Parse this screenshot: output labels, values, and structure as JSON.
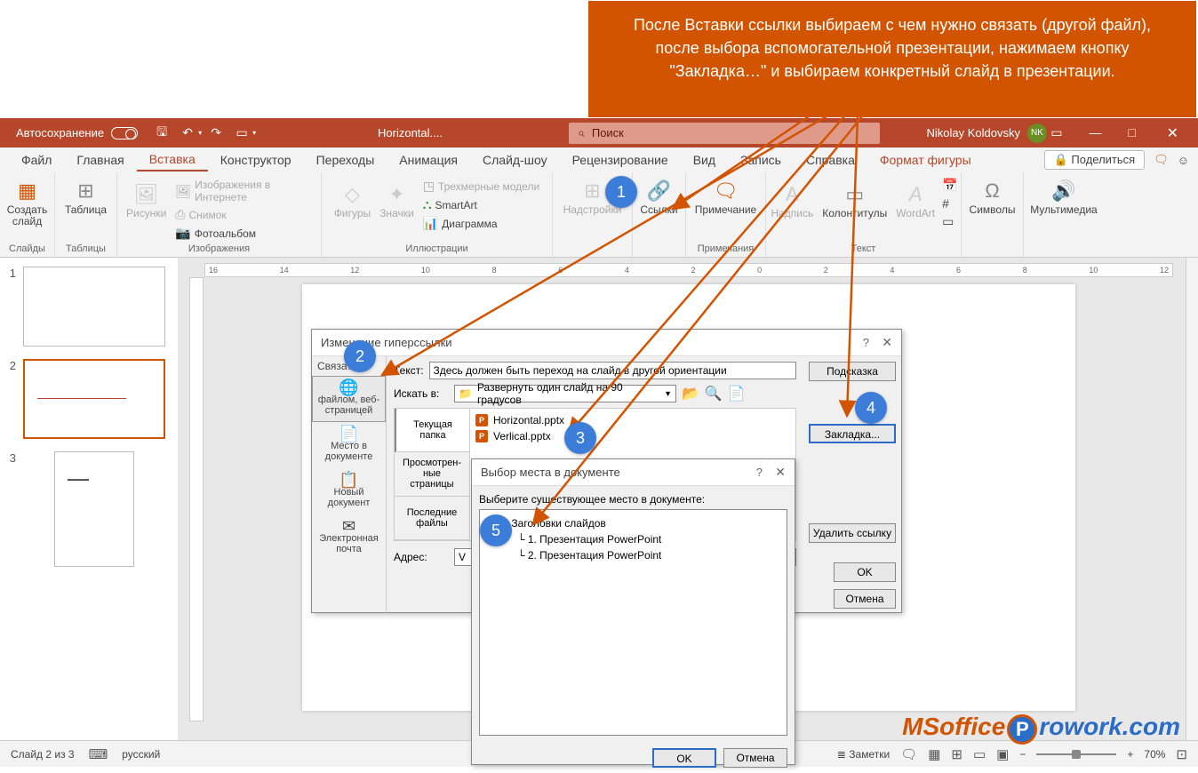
{
  "callout_text": "После Вставки ссылки выбираем с чем нужно связать (другой файл), после выбора вспомогательной презентации, нажимаем кнопку \"Закладка…\" и выбираем конкретный слайд в презентации.",
  "titlebar": {
    "autosave": "Автосохранение",
    "doc_title": "Horizontal....",
    "search_placeholder": "Поиск",
    "user_name": "Nikolay Koldovsky",
    "user_initials": "NK"
  },
  "tabs": {
    "file": "Файл",
    "home": "Главная",
    "insert": "Вставка",
    "design": "Конструктор",
    "transitions": "Переходы",
    "animations": "Анимация",
    "slideshow": "Слайд-шоу",
    "review": "Рецензирование",
    "view": "Вид",
    "record": "Запись",
    "help": "Справка",
    "format": "Формат фигуры",
    "share": "Поделиться"
  },
  "ribbon": {
    "slides": {
      "label": "Слайды",
      "new_slide": "Создать\nслайд"
    },
    "tables": {
      "label": "Таблицы",
      "table": "Таблица"
    },
    "images": {
      "label": "Изображения",
      "pictures": "Рисунки",
      "online": "Изображения в Интернете",
      "screenshot": "Снимок",
      "album": "Фотоальбом"
    },
    "illustrations": {
      "label": "Иллюстрации",
      "shapes": "Фигуры",
      "icons": "Значки",
      "models": "Трехмерные модели",
      "smartart": "SmartArt",
      "chart": "Диаграмма"
    },
    "addins": {
      "label": "",
      "addins": "Надстройки"
    },
    "links": {
      "label": "",
      "links": "Ссылки"
    },
    "comments": {
      "label": "Примечания",
      "comment": "Примечание"
    },
    "text": {
      "label": "Текст",
      "textbox": "Надпись",
      "headerfooter": "Колонтитулы",
      "wordart": "WordArt"
    },
    "symbols": {
      "label": "",
      "symbols": "Символы"
    },
    "media": {
      "label": "",
      "media": "Мультимедиа"
    }
  },
  "thumbs": {
    "n1": "1",
    "n2": "2",
    "n3": "3"
  },
  "dlg1": {
    "title": "Изменение гиперссылки",
    "link_to": "Связать с:",
    "text_label": "Текст:",
    "text_value": "Здесь должен быть переход на слайд в другой ориентации",
    "hint_btn": "Подсказка",
    "search_in": "Искать в:",
    "folder": "Развернуть один слайд на 90 градусов",
    "opt_file": "файлом, веб-\nстраницей",
    "opt_place": "Место в\nдокументе",
    "opt_new": "Новый\nдокумент",
    "opt_email": "Электронная\nпочта",
    "tab_current": "Текущая\nпапка",
    "tab_viewed": "Просмотрен-\nные\nстраницы",
    "tab_recent": "Последние\nфайлы",
    "file1": "Horizontal.pptx",
    "file2": "Verlical.pptx",
    "bookmark": "Закладка...",
    "remove": "Удалить ссылку",
    "addr_label": "Адрес:",
    "addr_value": "V",
    "ok": "OK",
    "cancel": "Отмена"
  },
  "dlg2": {
    "title": "Выбор места в документе",
    "prompt": "Выберите существующее место в документе:",
    "root": "Заголовки слайдов",
    "item1": "1. Презентация PowerPoint",
    "item2": "2. Презентация PowerPoint",
    "ok": "OK",
    "cancel": "Отмена"
  },
  "status": {
    "slide": "Слайд 2 из 3",
    "lang": "русский",
    "notes": "Заметки",
    "zoom": "70%"
  },
  "watermark": {
    "p1": "MSoffice",
    "p2": "rowork.com"
  }
}
